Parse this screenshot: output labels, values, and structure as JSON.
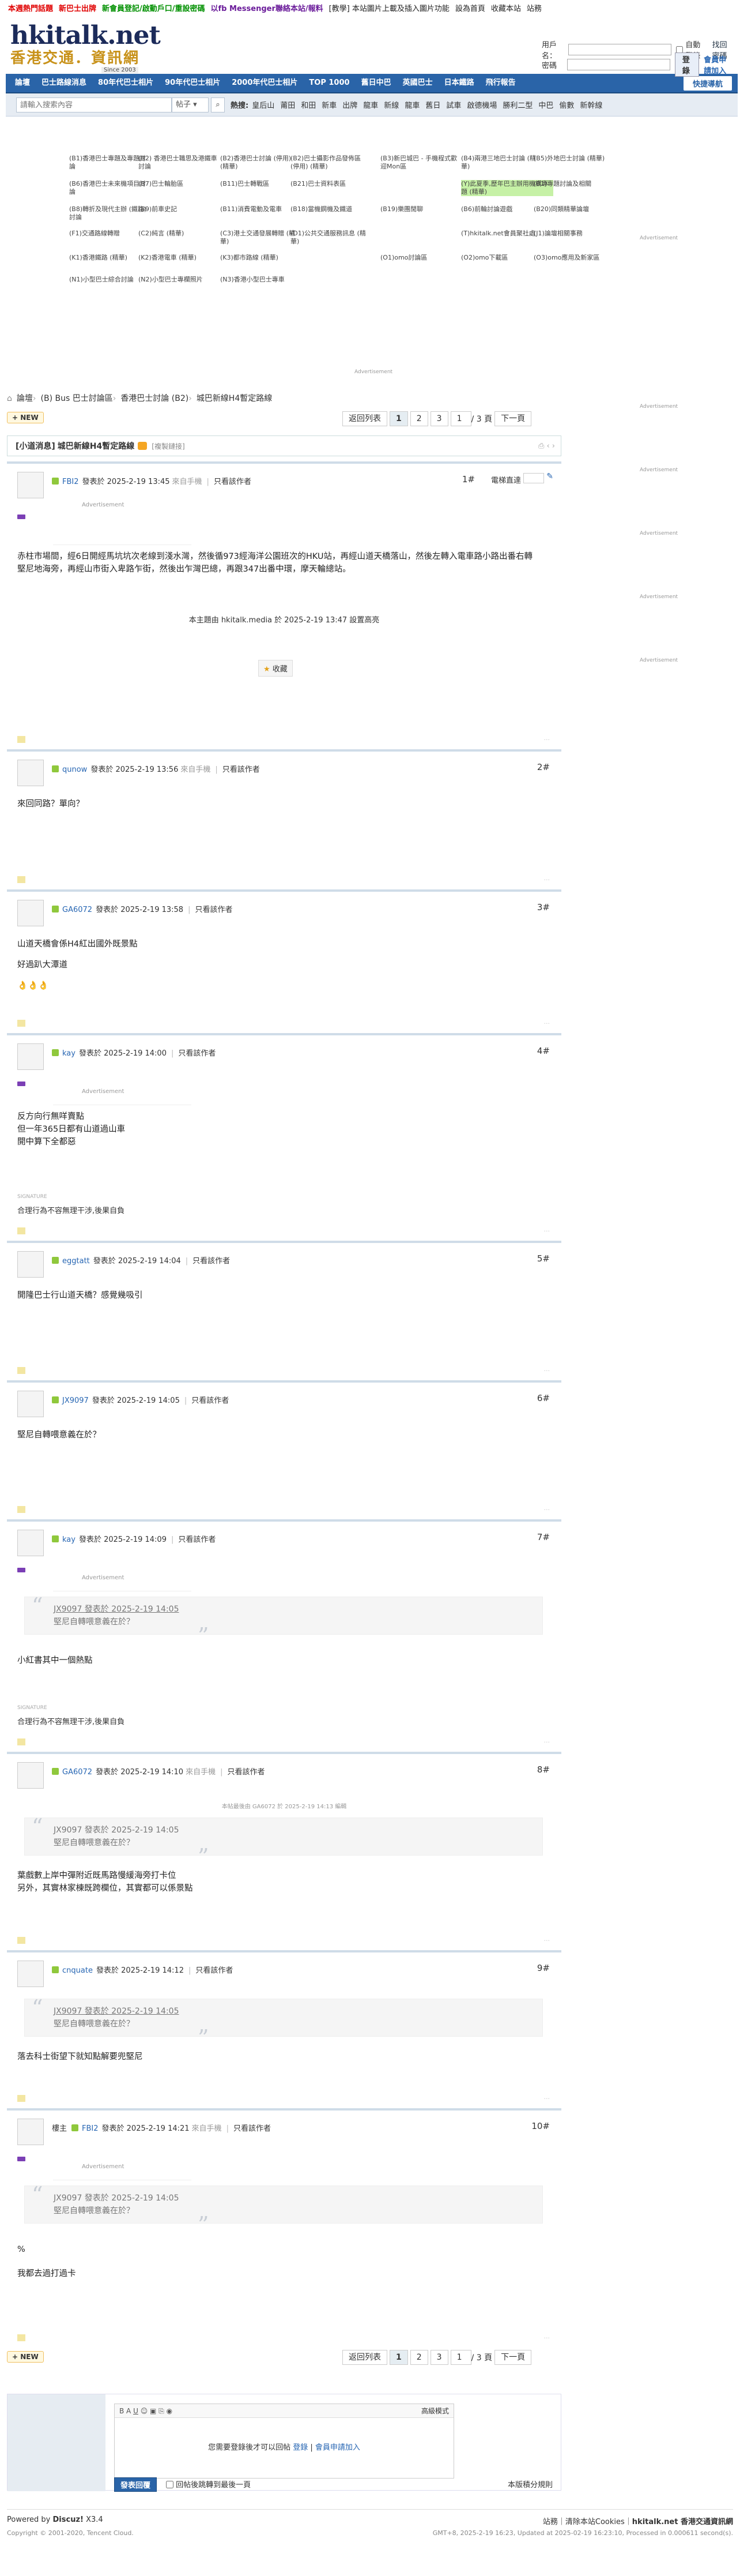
{
  "topbar": [
    {
      "t": "本週熱門話題",
      "c": "#e00000"
    },
    {
      "t": "新巴士出牌",
      "c": "#e00000"
    },
    {
      "t": "新會員登記/啟動戶口/重設密碼",
      "c": "#009000"
    },
    {
      "t": "以fb Messenger聯絡本站/報料",
      "c": "#6a1b9a"
    },
    {
      "t": "[教學] 本站圖片上載及插入圖片功能",
      "c": "#222"
    },
    {
      "t": "設為首頁",
      "c": "#222"
    },
    {
      "t": "收藏本站",
      "c": "#222"
    },
    {
      "t": "站務",
      "c": "#222"
    }
  ],
  "logo": {
    "line1": "hkitalk.net",
    "line2": "香港交通．資訊網",
    "since": "Since 2003"
  },
  "login": {
    "user_label": "用戶名：",
    "pass_label": "密碼",
    "auto": "自動登錄",
    "forgot": "找回密碼",
    "submit": "登錄",
    "register": "會員申請加入"
  },
  "nav": {
    "items": [
      "論壇",
      "巴士路線消息",
      "80年代巴士相片",
      "90年代巴士相片",
      "2000年代巴士相片",
      "TOP 1000",
      "舊日中巴",
      "英國巴士",
      "日本鐵路",
      "飛行報告"
    ],
    "quick": "快捷導航"
  },
  "search": {
    "placeholder": "請輸入搜索內容",
    "type": "帖子",
    "hot_label": "熱搜:",
    "hot": [
      "皇后山",
      "莆田",
      "和田",
      "新車",
      "出牌",
      "龍車",
      "新線",
      "龍車",
      "舊日",
      "試車",
      "啟德機場",
      "勝利二型",
      "中巴",
      "偷數",
      "新幹線"
    ]
  },
  "forums": [
    [
      "(B1)香港巴士專題及專題討論",
      "(B2) 香港巴士職思及港鐵車討論",
      "(B2)香港巴士討論 (停用) (精華)",
      "(B2)巴士攝影作品發佈區 (停用) (精華)",
      "(B3)新巴城巴 - 手機程式歡迎Mon區",
      "(B4)兩港三地巴士討論 (精華)",
      "(B5)外地巴士討論 (精華)"
    ],
    [
      "(B6)香港巴士未來機項目討論",
      "(B7)巴士輪胎區",
      "(B11)巴士轉戰區",
      "(B21)巴士資料表區",
      "",
      "(Y)此夏季,歷年巴主辦用機構專題 (精華)",
      "(B1)專題討論及相關"
    ],
    [
      "(B8)轉折及現代主辦 (鐵路) 討論",
      "(B9)前車史記",
      "(B11)消費電動及電車",
      "(B18)當機鋼機及鐵道",
      "(B19)樂團閒聊",
      "(B6)前輪討論遊戲",
      "(B20)同類精華論壇"
    ],
    [
      "(F1)交通路線轉贈",
      "(C2)純言 (精華)",
      "(C3)港土交通發展轉贈 (精華)",
      "(D1)公共交通服務訊息 (精華)",
      "",
      "(T)hkitalk.net會員聚社處",
      "(J1)論壇相關事務"
    ],
    [
      "(K1)香港鐵路 (精華)",
      "(K2)香港電車 (精華)",
      "(K3)都市路線 (精華)",
      "",
      "(O1)omo討論區",
      "(O2)omo下載區",
      "(O3)omo應用及新家區"
    ],
    [
      "(N1)小型巴士綜合討論",
      "(N2)小型巴士專欄照片",
      "(N3)香港小型巴士專車"
    ]
  ],
  "ad": "Advertisement",
  "crumb": [
    "論壇",
    "(B) Bus 巴士討論區",
    "香港巴士討論 (B2)",
    "城巴新線H4暫定路線"
  ],
  "pager": {
    "prev": "返回列表",
    "pages": [
      "1",
      "2",
      "3"
    ],
    "jump": "1",
    "total": "/ 3 頁",
    "next": "下一頁"
  },
  "new_btn": "NEW",
  "thread": {
    "prefix": "[小道消息]",
    "title": "城巴新線H4暫定路線",
    "copy": "[複製鏈接]",
    "tools": "⎙ ‹ ›"
  },
  "posts": [
    {
      "user": "FBI2",
      "time": "發表於 2025-2-19 13:45",
      "via": "來自手機",
      "only": "只看該作者",
      "floor": "1#",
      "speed": "電梯直達",
      "paras": [
        "赤柱市場間，經6日開經馬坑坑次老線到淺水灣，然後循973經海洋公園班次的HKU站，再經山道天橋落山，然後左轉入電車路小路出番右轉堅尼地海旁，再經山市街入卑路乍街，然後出乍灣巴總，再跟347出番中環，摩天輪總站。"
      ],
      "edited": "本主題由 hkitalk.media 於 2025-2-19 13:47 設置高亮",
      "fav": "收藏"
    },
    {
      "user": "qunow",
      "time": "發表於 2025-2-19 13:56",
      "via": "來自手機",
      "only": "只看該作者",
      "floor": "2#",
      "paras": [
        "來回同路？單向？"
      ]
    },
    {
      "user": "GA6072",
      "time": "發表於 2025-2-19 13:58",
      "via": "",
      "only": "只看該作者",
      "floor": "3#",
      "paras": [
        "山道天橋會係H4紅出國外既景點",
        "好過趴大潭道",
        "👌👌👌"
      ]
    },
    {
      "user": "kay",
      "time": "發表於 2025-2-19 14:00",
      "via": "",
      "only": "只看該作者",
      "floor": "4#",
      "paras": [
        "反方向行無咩賣點",
        "但一年365日都有山道過山車",
        "開中算下全都惡"
      ],
      "sig": "合理行為不容無理干涉,後果自負",
      "siglbl": "SIGNATURE"
    },
    {
      "user": "eggtatt",
      "time": "發表於 2025-2-19 14:04",
      "via": "",
      "only": "只看該作者",
      "floor": "5#",
      "paras": [
        "開隆巴士行山道天橋？感覺幾吸引"
      ]
    },
    {
      "user": "JX9097",
      "time": "發表於 2025-2-19 14:05",
      "via": "",
      "only": "只看該作者",
      "floor": "6#",
      "paras": [
        "堅尼自轉喂意義在於？"
      ]
    },
    {
      "user": "kay",
      "time": "發表於 2025-2-19 14:09",
      "via": "",
      "only": "只看該作者",
      "floor": "7#",
      "q_author": "JX9097 發表於 2025-2-19 14:05",
      "q_text": "堅尼自轉喂意義在於？",
      "paras": [
        "小紅書其中一個熱點"
      ],
      "sig": "合理行為不容無理干涉,後果自負",
      "siglbl": "SIGNATURE"
    },
    {
      "user": "GA6072",
      "time": "發表於 2025-2-19 14:10",
      "via": "來自手機",
      "only": "只看該作者",
      "floor": "8#",
      "edited": "本帖最後由 GA6072 於 2025-2-19 14:13 編輯",
      "q_author": "JX9097 發表於 2025-2-19 14:05",
      "q_text": "堅尼自轉喂意義在於？",
      "paras": [
        "葉戲數上岸中彈附近既馬路慢緩海旁打卡位",
        "另外，其實林家棟既跨欄位，其實都可以係景點"
      ]
    },
    {
      "user": "cnquate",
      "time": "發表於 2025-2-19 14:12",
      "via": "",
      "only": "只看該作者",
      "floor": "9#",
      "q_author": "JX9097 發表於 2025-2-19 14:05",
      "q_text": "堅尼自轉喂意義在於？",
      "paras": [
        "落去科士街望下就知點解要兜堅尼"
      ]
    },
    {
      "user": "FBI2",
      "pre": "樓主",
      "time": "發表於 2025-2-19 14:21",
      "via": "來自手機",
      "only": "只看該作者",
      "floor": "10#",
      "q_author": "JX9097 發表於 2025-2-19 14:05",
      "q_text": "堅尼自轉喂意義在於？",
      "paras": [
        "%",
        "我都去過打過卡"
      ]
    }
  ],
  "reply": {
    "adv": "高級模式",
    "msg1": "您需要登錄後才可以回帖",
    "login": "登錄",
    "sep": "|",
    "reg": "會員申請加入",
    "submit": "發表回覆",
    "check": "回帖後跳轉到最後一頁",
    "rule": "本版積分規則"
  },
  "footer": {
    "powered": "Powered by",
    "discuz": "Discuz!",
    "ver": "X3.4",
    "copy": "Copyright © 2001-2020, Tencent Cloud.",
    "links": "站務｜清除本站Cookies｜",
    "site": "hkitalk.net 香港交通資訊網",
    "time": "GMT+8, 2025-2-19 16:23, Updated at 2025-02-19 16:23:10, Processed in 0.000611 second(s)."
  }
}
